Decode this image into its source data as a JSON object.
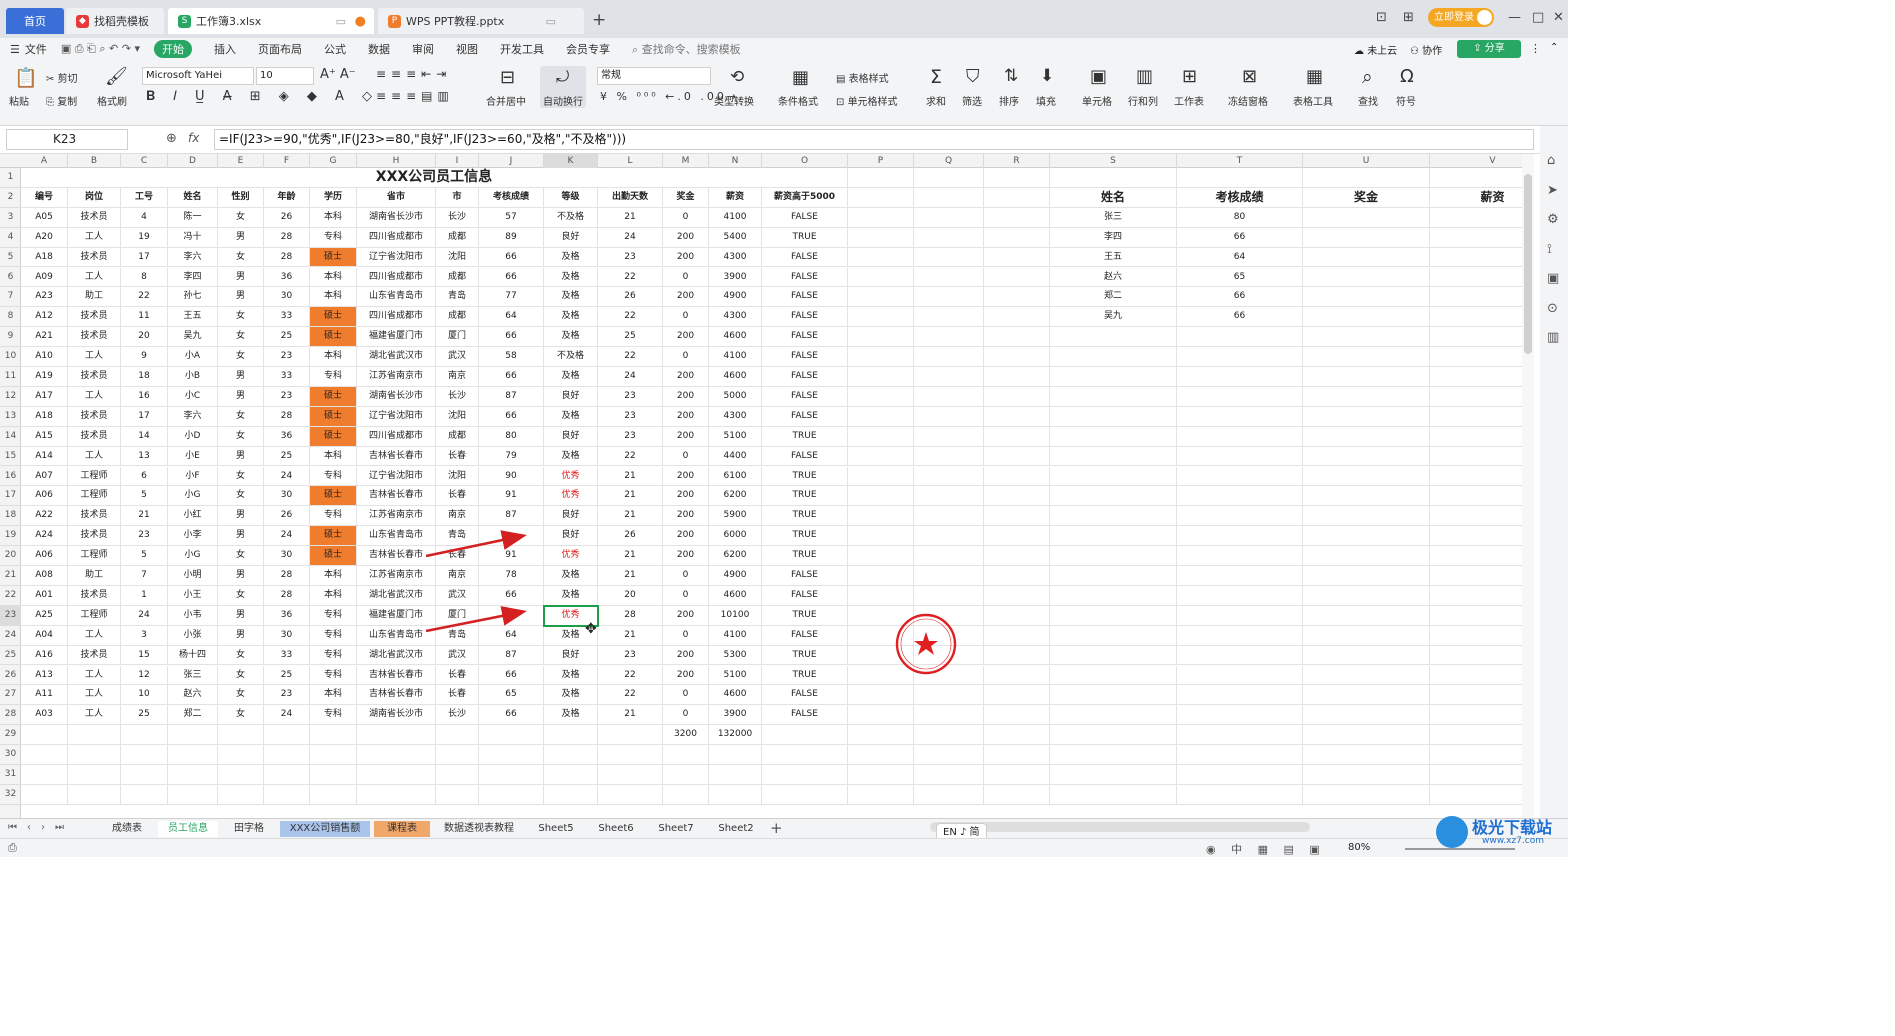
{
  "tabs": {
    "home": "首页",
    "t1": "找稻壳模板",
    "t2": "工作簿3.xlsx",
    "t3": "WPS PPT教程.pptx",
    "login": "立即登录"
  },
  "menu": [
    "文件",
    "开始",
    "插入",
    "页面布局",
    "公式",
    "数据",
    "审阅",
    "视图",
    "开发工具",
    "会员专享"
  ],
  "menu_search": "查找命令、搜索模板",
  "menu_right": {
    "cloud": "未上云",
    "collab": "协作",
    "share": "分享"
  },
  "ribbon": {
    "paste": "粘贴",
    "cut": "剪切",
    "copy": "复制",
    "painter": "格式刷",
    "font": "Microsoft YaHei",
    "size": "10",
    "merge": "合并居中",
    "wrap": "自动换行",
    "numfmt": "常规",
    "convert": "类型转换",
    "cond": "条件格式",
    "tablestyle": "表格样式",
    "cellstyle": "单元格样式",
    "sum": "求和",
    "filter": "筛选",
    "sort": "排序",
    "fill": "填充",
    "cell": "单元格",
    "rowcol": "行和列",
    "sheet": "工作表",
    "freeze": "冻结窗格",
    "tabletool": "表格工具",
    "find": "查找",
    "symbol": "符号"
  },
  "namebox": "K23",
  "formula": "=IF(J23>=90,\"优秀\",IF(J23>=80,\"良好\",IF(J23>=60,\"及格\",\"不及格\")))",
  "fx": "fx",
  "columns": [
    "A",
    "B",
    "C",
    "D",
    "E",
    "F",
    "G",
    "H",
    "I",
    "J",
    "K",
    "L",
    "M",
    "N",
    "O",
    "P",
    "Q",
    "R",
    "S",
    "T",
    "U",
    "V"
  ],
  "title": "XXX公司员工信息",
  "headers": [
    "编号",
    "岗位",
    "工号",
    "姓名",
    "性别",
    "年龄",
    "学历",
    "省市",
    "市",
    "考核成绩",
    "等级",
    "出勤天数",
    "奖金",
    "薪资",
    "薪资高于5000"
  ],
  "rows": [
    [
      "A05",
      "技术员",
      "4",
      "陈一",
      "女",
      "26",
      "本科",
      "湖南省长沙市",
      "长沙",
      "57",
      "不及格",
      "21",
      "0",
      "4100",
      "FALSE"
    ],
    [
      "A20",
      "工人",
      "19",
      "冯十",
      "男",
      "28",
      "专科",
      "四川省成都市",
      "成都",
      "89",
      "良好",
      "24",
      "200",
      "5400",
      "TRUE"
    ],
    [
      "A18",
      "技术员",
      "17",
      "李六",
      "女",
      "28",
      "硕士",
      "辽宁省沈阳市",
      "沈阳",
      "66",
      "及格",
      "23",
      "200",
      "4300",
      "FALSE"
    ],
    [
      "A09",
      "工人",
      "8",
      "李四",
      "男",
      "36",
      "本科",
      "四川省成都市",
      "成都",
      "66",
      "及格",
      "22",
      "0",
      "3900",
      "FALSE"
    ],
    [
      "A23",
      "助工",
      "22",
      "孙七",
      "男",
      "30",
      "本科",
      "山东省青岛市",
      "青岛",
      "77",
      "及格",
      "26",
      "200",
      "4900",
      "FALSE"
    ],
    [
      "A12",
      "技术员",
      "11",
      "王五",
      "女",
      "33",
      "硕士",
      "四川省成都市",
      "成都",
      "64",
      "及格",
      "22",
      "0",
      "4300",
      "FALSE"
    ],
    [
      "A21",
      "技术员",
      "20",
      "吴九",
      "女",
      "25",
      "硕士",
      "福建省厦门市",
      "厦门",
      "66",
      "及格",
      "25",
      "200",
      "4600",
      "FALSE"
    ],
    [
      "A10",
      "工人",
      "9",
      "小A",
      "女",
      "23",
      "本科",
      "湖北省武汉市",
      "武汉",
      "58",
      "不及格",
      "22",
      "0",
      "4100",
      "FALSE"
    ],
    [
      "A19",
      "技术员",
      "18",
      "小B",
      "男",
      "33",
      "专科",
      "江苏省南京市",
      "南京",
      "66",
      "及格",
      "24",
      "200",
      "4600",
      "FALSE"
    ],
    [
      "A17",
      "工人",
      "16",
      "小C",
      "男",
      "23",
      "硕士",
      "湖南省长沙市",
      "长沙",
      "87",
      "良好",
      "23",
      "200",
      "5000",
      "FALSE"
    ],
    [
      "A18",
      "技术员",
      "17",
      "李六",
      "女",
      "28",
      "硕士",
      "辽宁省沈阳市",
      "沈阳",
      "66",
      "及格",
      "23",
      "200",
      "4300",
      "FALSE"
    ],
    [
      "A15",
      "技术员",
      "14",
      "小D",
      "女",
      "36",
      "硕士",
      "四川省成都市",
      "成都",
      "80",
      "良好",
      "23",
      "200",
      "5100",
      "TRUE"
    ],
    [
      "A14",
      "工人",
      "13",
      "小E",
      "男",
      "25",
      "本科",
      "吉林省长春市",
      "长春",
      "79",
      "及格",
      "22",
      "0",
      "4400",
      "FALSE"
    ],
    [
      "A07",
      "工程师",
      "6",
      "小F",
      "女",
      "24",
      "专科",
      "辽宁省沈阳市",
      "沈阳",
      "90",
      "优秀",
      "21",
      "200",
      "6100",
      "TRUE"
    ],
    [
      "A06",
      "工程师",
      "5",
      "小G",
      "女",
      "30",
      "硕士",
      "吉林省长春市",
      "长春",
      "91",
      "优秀",
      "21",
      "200",
      "6200",
      "TRUE"
    ],
    [
      "A22",
      "技术员",
      "21",
      "小红",
      "男",
      "26",
      "专科",
      "江苏省南京市",
      "南京",
      "87",
      "良好",
      "21",
      "200",
      "5900",
      "TRUE"
    ],
    [
      "A24",
      "技术员",
      "23",
      "小李",
      "男",
      "24",
      "硕士",
      "山东省青岛市",
      "青岛",
      "",
      "良好",
      "26",
      "200",
      "6000",
      "TRUE"
    ],
    [
      "A06",
      "工程师",
      "5",
      "小G",
      "女",
      "30",
      "硕士",
      "吉林省长春市",
      "长春",
      "91",
      "优秀",
      "21",
      "200",
      "6200",
      "TRUE"
    ],
    [
      "A08",
      "助工",
      "7",
      "小明",
      "男",
      "28",
      "本科",
      "江苏省南京市",
      "南京",
      "78",
      "及格",
      "21",
      "0",
      "4900",
      "FALSE"
    ],
    [
      "A01",
      "技术员",
      "1",
      "小王",
      "女",
      "28",
      "本科",
      "湖北省武汉市",
      "武汉",
      "66",
      "及格",
      "20",
      "0",
      "4600",
      "FALSE"
    ],
    [
      "A25",
      "工程师",
      "24",
      "小韦",
      "男",
      "36",
      "专科",
      "福建省厦门市",
      "厦门",
      "",
      "优秀",
      "28",
      "200",
      "10100",
      "TRUE"
    ],
    [
      "A04",
      "工人",
      "3",
      "小张",
      "男",
      "30",
      "专科",
      "山东省青岛市",
      "青岛",
      "64",
      "及格",
      "21",
      "0",
      "4100",
      "FALSE"
    ],
    [
      "A16",
      "技术员",
      "15",
      "杨十四",
      "女",
      "33",
      "专科",
      "湖北省武汉市",
      "武汉",
      "87",
      "良好",
      "23",
      "200",
      "5300",
      "TRUE"
    ],
    [
      "A13",
      "工人",
      "12",
      "张三",
      "女",
      "25",
      "专科",
      "吉林省长春市",
      "长春",
      "66",
      "及格",
      "22",
      "200",
      "5100",
      "TRUE"
    ],
    [
      "A11",
      "工人",
      "10",
      "赵六",
      "女",
      "23",
      "本科",
      "吉林省长春市",
      "长春",
      "65",
      "及格",
      "22",
      "0",
      "4600",
      "FALSE"
    ],
    [
      "A03",
      "工人",
      "25",
      "郑二",
      "女",
      "24",
      "专科",
      "湖南省长沙市",
      "长沙",
      "66",
      "及格",
      "21",
      "0",
      "3900",
      "FALSE"
    ]
  ],
  "totals": {
    "bonus": "3200",
    "salary": "132000"
  },
  "side_headers": [
    "姓名",
    "考核成绩",
    "奖金",
    "薪资"
  ],
  "side_rows": [
    [
      "张三",
      "80"
    ],
    [
      "李四",
      "66"
    ],
    [
      "王五",
      "64"
    ],
    [
      "赵六",
      "65"
    ],
    [
      "郑二",
      "66"
    ],
    [
      "吴九",
      "66"
    ]
  ],
  "row_numbers": [
    "1",
    "2",
    "3",
    "4",
    "5",
    "6",
    "7",
    "8",
    "9",
    "10",
    "11",
    "12",
    "13",
    "14",
    "15",
    "16",
    "17",
    "18",
    "19",
    "20",
    "21",
    "22",
    "23",
    "24",
    "25",
    "26",
    "27",
    "28",
    "29",
    "30",
    "31",
    "32"
  ],
  "sheets": [
    "成绩表",
    "员工信息",
    "田字格",
    "XXX公司销售额",
    "课程表",
    "数据透视表教程",
    "Sheet5",
    "Sheet6",
    "Sheet7",
    "Sheet2"
  ],
  "ime": "EN ♪ 简",
  "zoom": "80%",
  "watermark": "极光下载站",
  "watermark_url": "www.xz7.com",
  "colors": {
    "accent": "#27a664",
    "orange": "#f07c2e",
    "red": "#e02020",
    "select": "#1e9e4a"
  }
}
